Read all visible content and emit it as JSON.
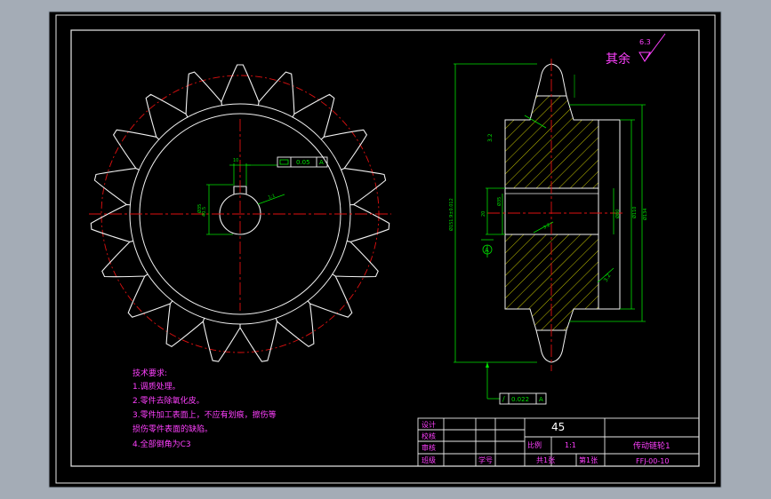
{
  "roughness": {
    "label": "其余",
    "value": "6.3"
  },
  "front_view": {
    "flatness_box": {
      "tolerance": "0.05",
      "datum": "A"
    },
    "keyway_width": "10",
    "bore_diameter": "Ø35",
    "keyway_depth": "40.5",
    "center_note": "1:1"
  },
  "section_view": {
    "roughness_top": "3.2",
    "roughness_bore": "3.2",
    "roughness_lower": "3.2",
    "pitch_dia": "Ø151.9±0.012",
    "hub_width": "20",
    "bore_dim": "Ø35",
    "hub_dia_1": "Ø80",
    "hub_dia_2": "Ø110",
    "outer_dia": "Ø134",
    "datum": "A",
    "runout_box": {
      "symbol": "/",
      "tolerance": "0.022",
      "datum": "A"
    }
  },
  "notes": {
    "title": "技术要求:",
    "lines": [
      "1.调质处理。",
      "2.零件去除氧化皮。",
      "3.零件加工表面上，不应有划痕，擦伤等",
      "损伤零件表面的缺陷。",
      "4.全部倒角为C3"
    ]
  },
  "title_block": {
    "material": "45",
    "rows": [
      "设计",
      "校核",
      "审核",
      "班级"
    ],
    "student_no_label": "学号",
    "scale_label": "比例",
    "scale_value": "1:1",
    "sheets_total": "共1张",
    "sheet_no": "第1张",
    "part_name": "传动链轮1",
    "drawing_no": "FFJ-00-10"
  }
}
